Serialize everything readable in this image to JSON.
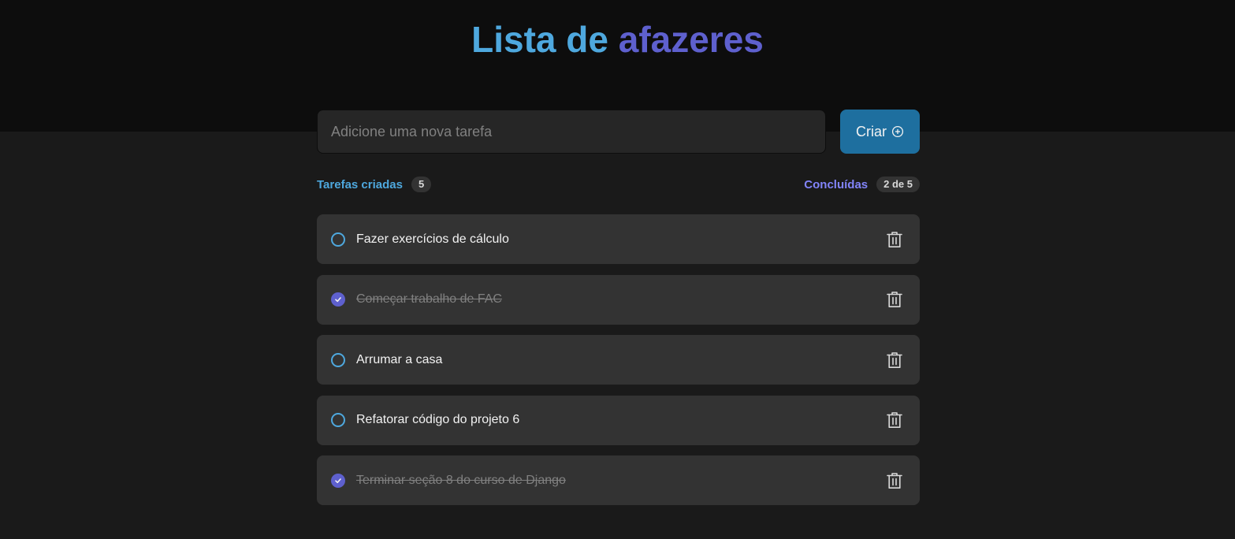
{
  "header": {
    "title_part1": "Lista de",
    "title_part2": "afazeres"
  },
  "form": {
    "placeholder": "Adicione uma nova tarefa",
    "value": "",
    "create_label": "Criar",
    "create_icon": "plus-circle-icon"
  },
  "counters": {
    "created_label": "Tarefas criadas",
    "created_count": "5",
    "done_label": "Concluídas",
    "done_count": "2 de 5"
  },
  "tasks": [
    {
      "text": "Fazer exercícios de cálculo",
      "done": false
    },
    {
      "text": "Começar trabalho de FAC",
      "done": true
    },
    {
      "text": "Arrumar a casa",
      "done": false
    },
    {
      "text": "Refatorar código do projeto 6",
      "done": false
    },
    {
      "text": "Terminar seção 8 do curso de Django",
      "done": true
    }
  ],
  "colors": {
    "blue": "#4ea8de",
    "purple": "#5e60ce",
    "purple_light": "#8284fa",
    "button": "#1e6f9f",
    "card": "#333333",
    "background": "#1a1a1a",
    "header_bg": "#0d0d0d"
  },
  "icons": {
    "check": "check-icon",
    "trash": "trash-icon"
  }
}
